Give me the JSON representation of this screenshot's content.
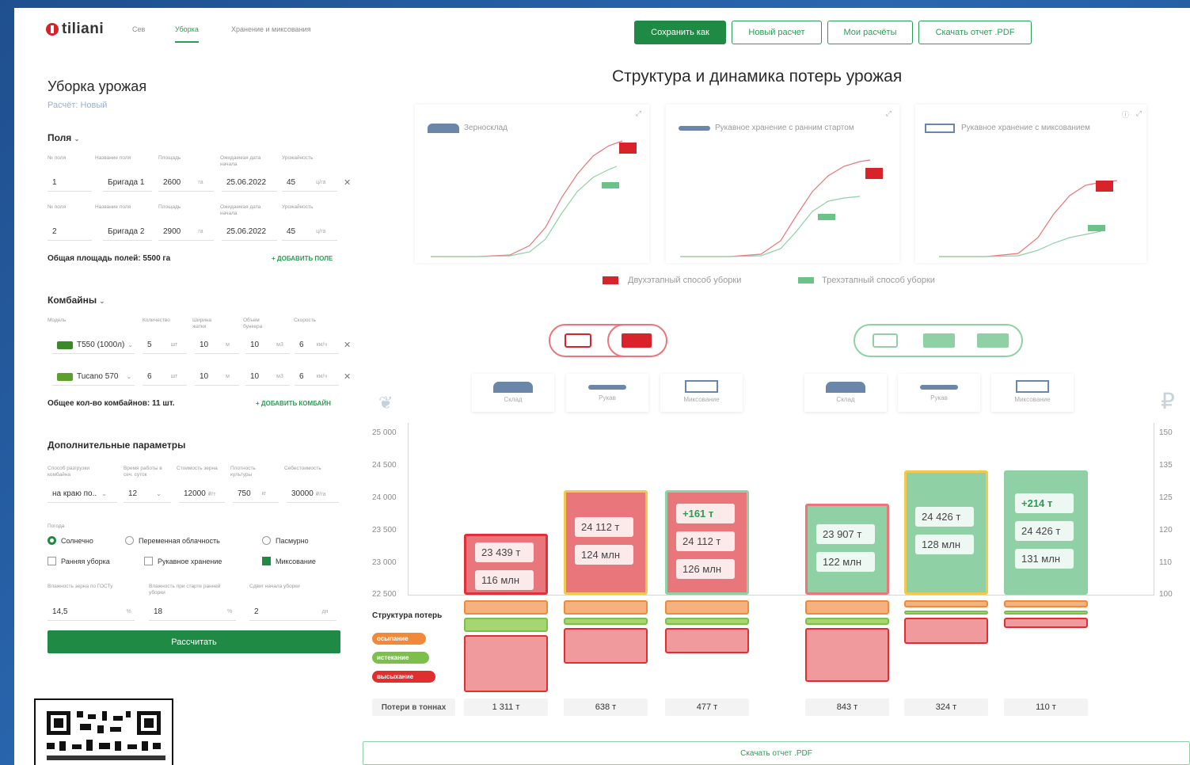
{
  "brand": {
    "logo_text": "tiliani"
  },
  "nav": {
    "tabs": [
      "Сев",
      "Уборка",
      "Хранение и миксования"
    ]
  },
  "toolbar": {
    "save_as": "Сохранить как",
    "new_calc": "Новый расчет",
    "my_calcs": "Мои расчёты",
    "download_pdf": "Скачать отчет .PDF"
  },
  "left": {
    "title": "Уборка урожая",
    "subtitle": "Расчёт: Новый",
    "fields": {
      "header": "Поля",
      "columns": [
        "№ поля",
        "Название поля",
        "Площадь",
        "Ожидаемая дата начала",
        "Урожайность"
      ],
      "rows": [
        {
          "num": "1",
          "name": "Бригада 1",
          "area": "2600",
          "area_unit": "га",
          "date": "25.06.2022",
          "yield": "45",
          "yield_unit": "ц/га"
        },
        {
          "num": "2",
          "name": "Бригада 2",
          "area": "2900",
          "area_unit": "га",
          "date": "25.06.2022",
          "yield": "45",
          "yield_unit": "ц/га"
        }
      ],
      "total": "Общая площадь полей: 5500 га",
      "add": "+ ДОБАВИТЬ ПОЛЕ"
    },
    "combines": {
      "header": "Комбайны",
      "columns": [
        "Модель",
        "Количество",
        "Ширина жатки",
        "Объем бункера",
        "Скорость"
      ],
      "rows": [
        {
          "model": "T550 (1000л)",
          "count": "5",
          "count_unit": "шт",
          "width": "10",
          "width_unit": "м",
          "volume": "10",
          "volume_unit": "м3",
          "speed": "6",
          "speed_unit": "км/ч"
        },
        {
          "model": "Tucano 570",
          "count": "6",
          "count_unit": "шт",
          "width": "10",
          "width_unit": "м",
          "volume": "10",
          "volume_unit": "м3",
          "speed": "6",
          "speed_unit": "км/ч"
        }
      ],
      "total": "Общее кол-во комбайнов: 11 шт.",
      "add": "+ ДОБАВИТЬ КОМБАЙН"
    },
    "extra": {
      "header": "Дополнительные параметры",
      "columns": [
        "Способ разгрузки комбайна",
        "Время работы в сеч. суток",
        "Стоимость зерна",
        "Плотность культуры",
        "Себестоимость"
      ],
      "values": {
        "unload": "на краю по..",
        "hours": "12",
        "price": "12000",
        "price_unit": "₽/т",
        "density": "750",
        "density_unit": "кг",
        "cost": "30000",
        "cost_unit": "₽/га"
      },
      "weather_label": "Погода",
      "weather": [
        "Солнечно",
        "Переменная облачность",
        "Пасмурно"
      ],
      "options": [
        "Ранняя уборка",
        "Рукавное хранение",
        "Миксование"
      ],
      "bottom_columns": [
        "Влажность зерна по ГОСТу",
        "Влажность при старте ранней уборки",
        "Сдвиг начала уборки"
      ],
      "bottom_values": {
        "humidity": "14,5",
        "humidity_unit": "%",
        "early": "18",
        "early_unit": "%",
        "shift": "2",
        "shift_unit": "дн"
      }
    },
    "calc_button": "Рассчитать"
  },
  "main": {
    "title": "Структура и динамика потерь урожая",
    "cards": [
      "Зерносклад",
      "Рукавное хранение с ранним стартом",
      "Рукавное хранение с миксованием"
    ],
    "legend": [
      "Двухэтапный способ уборки",
      "Трехэтапный способ уборки"
    ],
    "storage_labels": [
      "Склад",
      "Рукав",
      "Миксование",
      "Склад",
      "Рукав",
      "Миксование"
    ],
    "y_left": [
      "25 000",
      "24 500",
      "24 000",
      "23 500",
      "23 000",
      "22 500"
    ],
    "y_right": [
      "150",
      "135",
      "125",
      "120",
      "110",
      "100"
    ],
    "loss_structure_label": "Структура потерь",
    "loss_types": [
      "осыпание",
      "истекание",
      "высыхание"
    ],
    "loss_tons_label": "Потери в тоннах",
    "download_pdf": "Скачать отчет .PDF"
  },
  "colors": {
    "accent": "#1f8a44",
    "red": "#e9767a",
    "green": "#8fd1a5",
    "orange": "#f6b27d",
    "lightgreen": "#a6d672",
    "yellowborder": "#f2c94c"
  },
  "chart_data": {
    "type": "bar",
    "categories": [
      "Склад",
      "Рукав",
      "Миксование",
      "Склад",
      "Рукав",
      "Миксование"
    ],
    "series": [
      {
        "name": "Двухэтапный способ уборки",
        "values": [
          23439,
          24112,
          24112,
          null,
          null,
          null
        ]
      },
      {
        "name": "Трехэтапный способ уборки",
        "values": [
          null,
          null,
          null,
          23907,
          24426,
          24426
        ]
      }
    ],
    "tons_labels": [
      "23 439 т",
      "24 112 т",
      "24 112 т",
      "23 907 т",
      "24 426 т",
      "24 426 т"
    ],
    "money_labels": [
      "116 млн",
      "124 млн",
      "126 млн",
      "122 млн",
      "128 млн",
      "131 млн"
    ],
    "delta_labels": [
      "",
      "",
      "+161 т",
      "",
      "",
      "+214 т"
    ],
    "losses_tons": [
      "1 311 т",
      "638 т",
      "477 т",
      "843 т",
      "324 т",
      "110 т"
    ],
    "loss_layers": [
      {
        "osypanie": 1,
        "istekanie": 1,
        "vysykhanie": 4
      },
      {
        "osypanie": 1,
        "istekanie": 0.5,
        "vysykhanie": 2.5
      },
      {
        "osypanie": 1,
        "istekanie": 0.5,
        "vysykhanie": 1.8
      },
      {
        "osypanie": 1,
        "istekanie": 0.5,
        "vysykhanie": 3.8
      },
      {
        "osypanie": 0.5,
        "istekanie": 0.3,
        "vysykhanie": 1.8
      },
      {
        "osypanie": 0.5,
        "istekanie": 0.3,
        "vysykhanie": 0.7
      }
    ],
    "ylim": [
      22500,
      25000
    ],
    "ylim_right": [
      100,
      150
    ]
  }
}
